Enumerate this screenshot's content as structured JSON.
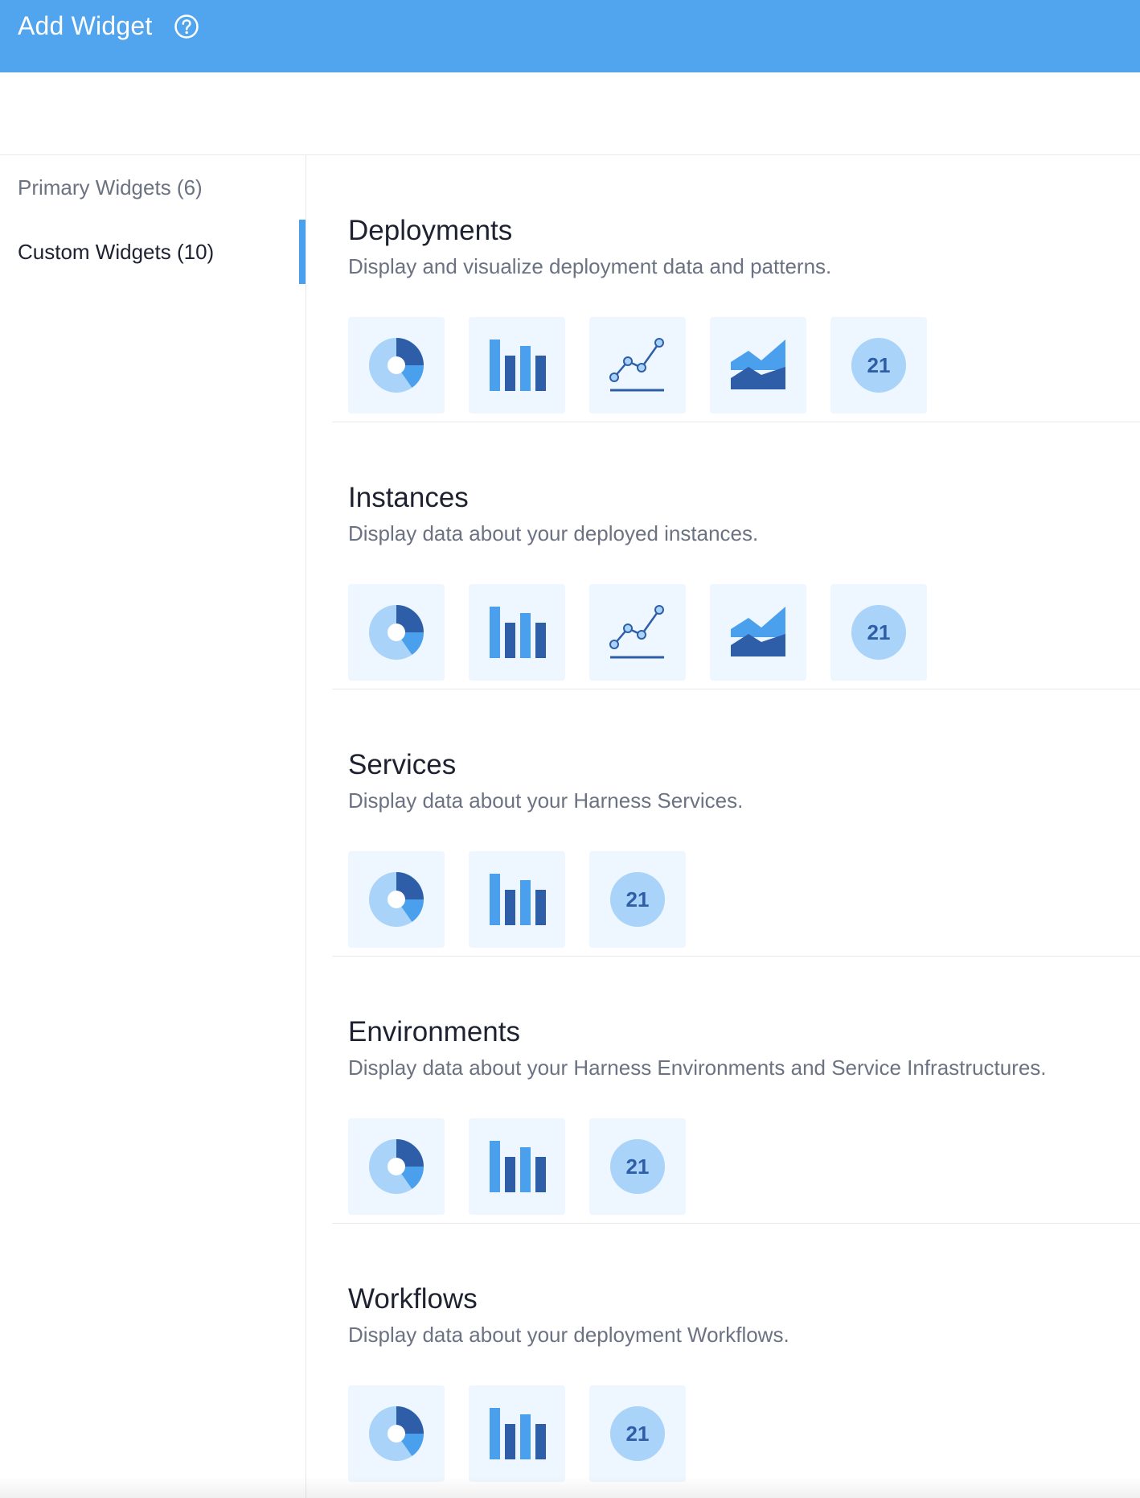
{
  "header": {
    "title": "Add Widget",
    "help_icon": "help-circle-icon"
  },
  "sidebar": {
    "items": [
      {
        "label": "Primary Widgets (6)",
        "active": false
      },
      {
        "label": "Custom Widgets (10)",
        "active": true
      }
    ]
  },
  "colors": {
    "header": "#51a5ee",
    "accent": "#4aa0ec",
    "tile_bg": "#eef6ff",
    "dark_blue": "#2f5ea8",
    "mid_blue": "#4aa0ec",
    "light_blue": "#a9d3f8"
  },
  "categories": [
    {
      "title": "Deployments",
      "description": "Display and visualize deployment data and patterns.",
      "widgets": [
        {
          "type": "pie",
          "icon": "pie-chart-icon"
        },
        {
          "type": "bar",
          "icon": "bar-chart-icon"
        },
        {
          "type": "line",
          "icon": "line-chart-icon"
        },
        {
          "type": "area",
          "icon": "area-chart-icon"
        },
        {
          "type": "number",
          "icon": "number-icon",
          "value": "21"
        }
      ]
    },
    {
      "title": "Instances",
      "description": "Display data about your deployed instances.",
      "widgets": [
        {
          "type": "pie",
          "icon": "pie-chart-icon"
        },
        {
          "type": "bar",
          "icon": "bar-chart-icon"
        },
        {
          "type": "line",
          "icon": "line-chart-icon"
        },
        {
          "type": "area",
          "icon": "area-chart-icon"
        },
        {
          "type": "number",
          "icon": "number-icon",
          "value": "21"
        }
      ]
    },
    {
      "title": "Services",
      "description": "Display data about your Harness Services.",
      "widgets": [
        {
          "type": "pie",
          "icon": "pie-chart-icon"
        },
        {
          "type": "bar",
          "icon": "bar-chart-icon"
        },
        {
          "type": "number",
          "icon": "number-icon",
          "value": "21"
        }
      ]
    },
    {
      "title": "Environments",
      "description": "Display data about your Harness Environments and Service Infrastructures.",
      "widgets": [
        {
          "type": "pie",
          "icon": "pie-chart-icon"
        },
        {
          "type": "bar",
          "icon": "bar-chart-icon"
        },
        {
          "type": "number",
          "icon": "number-icon",
          "value": "21"
        }
      ]
    },
    {
      "title": "Workflows",
      "description": "Display data about your deployment Workflows.",
      "widgets": [
        {
          "type": "pie",
          "icon": "pie-chart-icon"
        },
        {
          "type": "bar",
          "icon": "bar-chart-icon"
        },
        {
          "type": "number",
          "icon": "number-icon",
          "value": "21"
        }
      ]
    }
  ]
}
